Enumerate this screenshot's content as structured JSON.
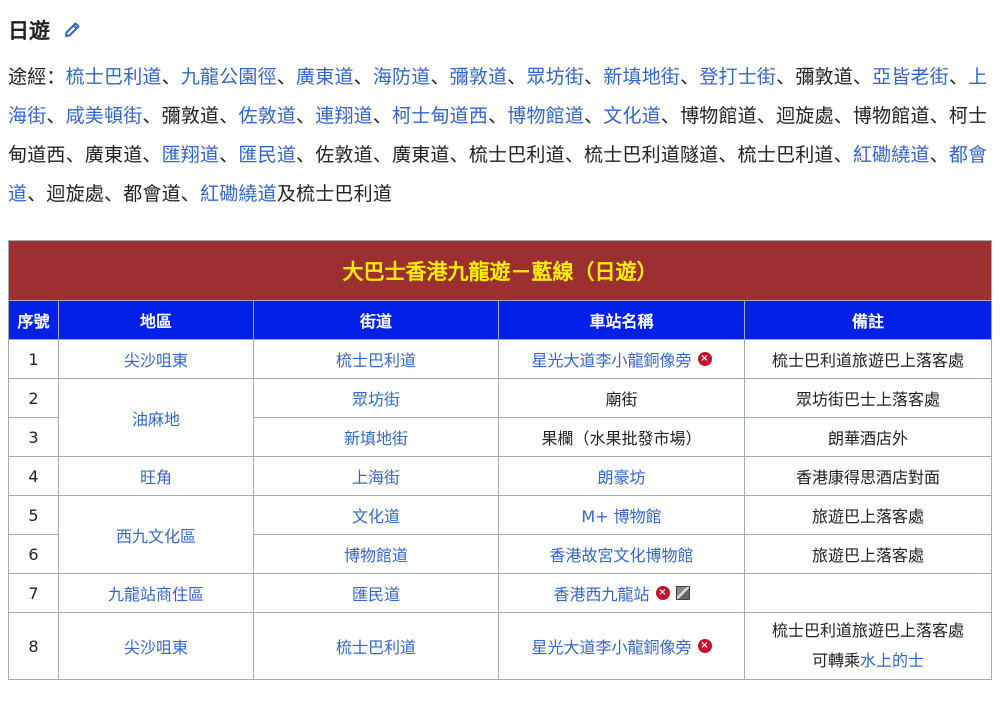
{
  "section": {
    "title": "日遊"
  },
  "route": {
    "prefix": "途經：",
    "segments": [
      {
        "text": "梳士巴利道",
        "link": true
      },
      {
        "text": "、",
        "link": false
      },
      {
        "text": "九龍公園徑",
        "link": true
      },
      {
        "text": "、",
        "link": false
      },
      {
        "text": "廣東道",
        "link": true
      },
      {
        "text": "、",
        "link": false
      },
      {
        "text": "海防道",
        "link": true
      },
      {
        "text": "、",
        "link": false
      },
      {
        "text": "彌敦道",
        "link": true
      },
      {
        "text": "、",
        "link": false
      },
      {
        "text": "眾坊街",
        "link": true
      },
      {
        "text": "、",
        "link": false
      },
      {
        "text": "新填地街",
        "link": true
      },
      {
        "text": "、",
        "link": false
      },
      {
        "text": "登打士街",
        "link": true
      },
      {
        "text": "、彌敦道、",
        "link": false
      },
      {
        "text": "亞皆老街",
        "link": true
      },
      {
        "text": "、",
        "link": false
      },
      {
        "text": "上海街",
        "link": true
      },
      {
        "text": "、",
        "link": false
      },
      {
        "text": "咸美頓街",
        "link": true
      },
      {
        "text": "、彌敦道、",
        "link": false
      },
      {
        "text": "佐敦道",
        "link": true
      },
      {
        "text": "、",
        "link": false
      },
      {
        "text": "連翔道",
        "link": true
      },
      {
        "text": "、",
        "link": false
      },
      {
        "text": "柯士甸道西",
        "link": true
      },
      {
        "text": "、",
        "link": false
      },
      {
        "text": "博物館道",
        "link": true
      },
      {
        "text": "、",
        "link": false
      },
      {
        "text": "文化道",
        "link": true
      },
      {
        "text": "、博物館道、迴旋處、博物館道、柯士甸道西、廣東道、",
        "link": false
      },
      {
        "text": "匯翔道",
        "link": true
      },
      {
        "text": "、",
        "link": false
      },
      {
        "text": "匯民道",
        "link": true
      },
      {
        "text": "、佐敦道、廣東道、梳士巴利道、梳士巴利道隧道、梳士巴利道、",
        "link": false
      },
      {
        "text": "紅磡繞道",
        "link": true
      },
      {
        "text": "、",
        "link": false
      },
      {
        "text": "都會道",
        "link": true
      },
      {
        "text": "、迴旋處、都會道、",
        "link": false
      },
      {
        "text": "紅磡繞道",
        "link": true
      },
      {
        "text": "及梳士巴利道",
        "link": false
      }
    ]
  },
  "table": {
    "title": "大巴士香港九龍遊－藍線（日遊）",
    "headers": {
      "no": "序號",
      "district": "地區",
      "street": "街道",
      "station": "車站名稱",
      "remark": "備註"
    },
    "rows": [
      {
        "no": "1",
        "district": "尖沙咀東",
        "street": "梳士巴利道",
        "station": "星光大道李小龍銅像旁",
        "badge": true,
        "rail": false,
        "remark": "梳士巴利道旅遊巴上落客處"
      },
      {
        "no": "2",
        "district": "油麻地",
        "street": "眾坊街",
        "station": "廟街",
        "station_link": false,
        "remark": "眾坊街巴士上落客處"
      },
      {
        "no": "3",
        "street": "新填地街",
        "station": "果欄（水果批發市場）",
        "station_link": false,
        "remark": "朗華酒店外"
      },
      {
        "no": "4",
        "district": "旺角",
        "street": "上海街",
        "station": "朗豪坊",
        "remark": "香港康得思酒店對面"
      },
      {
        "no": "5",
        "district": "西九文化區",
        "street": "文化道",
        "station": "M+ 博物館",
        "remark": "旅遊巴上落客處"
      },
      {
        "no": "6",
        "street": "博物館道",
        "station": "香港故宮文化博物館",
        "remark": "旅遊巴上落客處"
      },
      {
        "no": "7",
        "district": "九龍站商住區",
        "street": "匯民道",
        "station": "香港西九龍站",
        "badge": true,
        "rail": true,
        "remark": ""
      },
      {
        "no": "8",
        "district": "尖沙咀東",
        "street": "梳士巴利道",
        "station": "星光大道李小龍銅像旁",
        "badge": true,
        "remark_line1": "梳士巴利道旅遊巴上落客處",
        "remark_line2_prefix": "可轉乘",
        "remark_line2_link": "水上的士"
      }
    ]
  },
  "colors": {
    "link": "#3366cc",
    "title_bg": "#9c2f2f",
    "title_text": "#ffee00",
    "header_bg": "#0020e8",
    "badge": "#c8102e"
  }
}
